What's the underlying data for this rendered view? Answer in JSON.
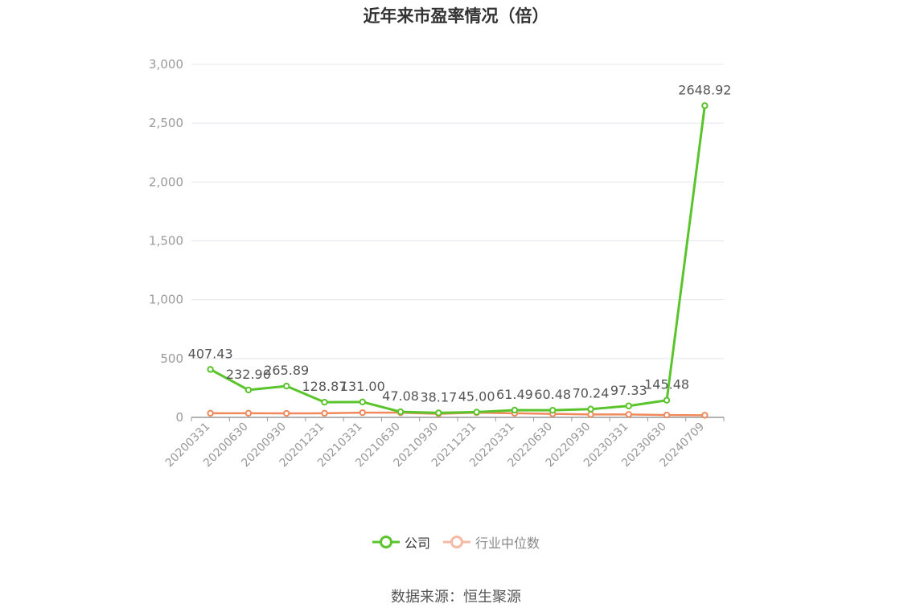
{
  "colors": {
    "company": "#5ac42c",
    "industry": "#f08a5d",
    "grid": "#e4e7ee",
    "axis": "#999999",
    "tick_text": "#999999",
    "label_text": "#555555"
  },
  "source_text": "数据来源：恒生聚源",
  "chart_data": {
    "type": "line",
    "title": "近年来市盈率情况（倍）",
    "xlabel": "",
    "ylabel": "",
    "ylim": [
      0,
      3000
    ],
    "yticks": [
      0,
      500,
      1000,
      1500,
      2000,
      2500,
      3000
    ],
    "ytick_labels": [
      "0",
      "500",
      "1,000",
      "1,500",
      "2,000",
      "2,500",
      "3,000"
    ],
    "grid": true,
    "legend_position": "bottom",
    "categories": [
      "20200331",
      "20200630",
      "20200930",
      "20201231",
      "20210331",
      "20210630",
      "20210930",
      "20211231",
      "20220331",
      "20220630",
      "20220930",
      "20230331",
      "20230630",
      "20240709"
    ],
    "series": [
      {
        "name": "公司",
        "values": [
          407.43,
          232.9,
          265.89,
          128.87,
          131.0,
          47.08,
          38.17,
          45.0,
          61.49,
          60.48,
          70.24,
          97.33,
          145.48,
          2648.92
        ],
        "labels": [
          "407.43",
          "232.90",
          "265.89",
          "128.87",
          "131.00",
          "47.08",
          "38.17",
          "45.00",
          "61.49",
          "60.48",
          "70.24",
          "97.33",
          "145.48",
          "2648.92"
        ]
      },
      {
        "name": "行业中位数",
        "values": [
          35,
          35,
          34,
          35,
          40,
          40,
          30,
          40,
          35,
          30,
          25,
          25,
          20,
          18
        ]
      }
    ]
  }
}
